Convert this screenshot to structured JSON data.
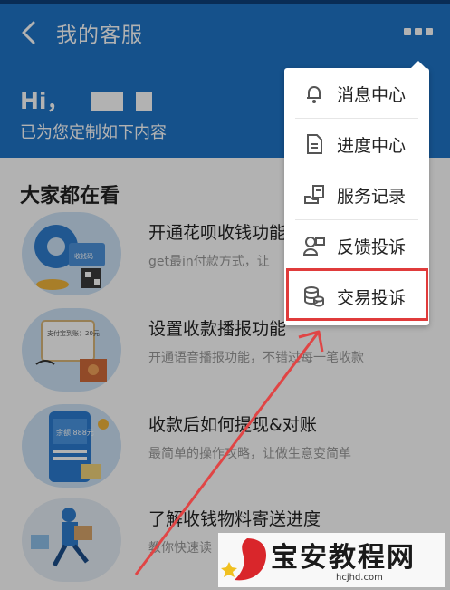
{
  "header": {
    "title": "我的客服",
    "greeting": "Hi，",
    "subtitle": "已为您定制如下内容"
  },
  "section": {
    "title": "大家都在看"
  },
  "cards": [
    {
      "title": "开通花呗收钱功能",
      "desc": "get最in付款方式，让",
      "thumb_text": "收钱码"
    },
    {
      "title": "设置收款播报功能",
      "desc": "开通语音播报功能，不错过每一笔收款",
      "thumb_text": "支付宝到账：20元"
    },
    {
      "title": "收款后如何提现&对账",
      "desc": "最简单的操作攻略，让做生意变简单",
      "thumb_text": "余额 888元"
    },
    {
      "title": "了解收钱物料寄送进度",
      "desc": "教你快速读",
      "thumb_text": ""
    }
  ],
  "menu": {
    "items": [
      {
        "label": "消息中心",
        "icon": "bell-icon"
      },
      {
        "label": "进度中心",
        "icon": "document-icon"
      },
      {
        "label": "服务记录",
        "icon": "service-record-icon"
      },
      {
        "label": "反馈投诉",
        "icon": "feedback-icon"
      },
      {
        "label": "交易投诉",
        "icon": "coins-icon"
      }
    ],
    "highlighted_index": 4
  },
  "watermark": {
    "text": "宝安教程网",
    "url": "hcjhd.com"
  },
  "colors": {
    "header_bg": "#1f74c7",
    "highlight": "#e03b3b",
    "arrow": "#e04545"
  }
}
